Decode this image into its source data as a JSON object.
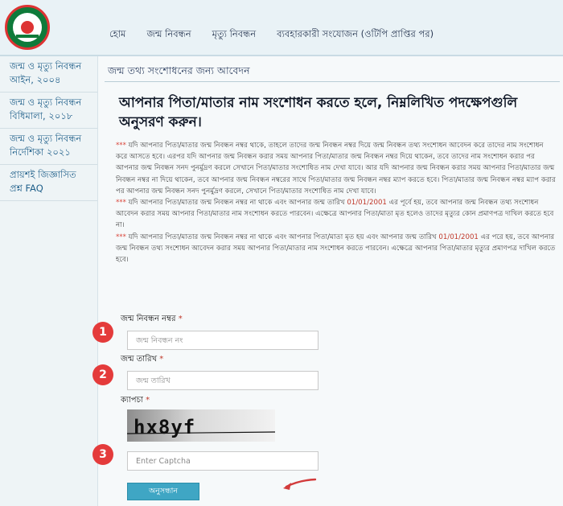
{
  "header": {
    "nav": [
      "হোম",
      "জন্ম নিবন্ধন",
      "মৃত্যু নিবন্ধন",
      "ব্যবহারকারী সংযোজন (ওটিপি প্রাপ্তির পর)"
    ]
  },
  "sidebar": {
    "items": [
      "জন্ম ও মৃত্যু নিবন্ধন আইন, ২০০৪",
      "জন্ম ও মৃত্যু নিবন্ধন বিধিমালা, ২০১৮",
      "জন্ম ও মৃত্যু নিবন্ধন নির্দেশিকা ২০২১",
      "প্রায়শই জিজ্ঞাসিত প্রশ্ন FAQ"
    ]
  },
  "main": {
    "page_title": "জন্ম তথ্য সংশোধনের জন্য আবেদন",
    "heading": "আপনার পিতা/মাতার নাম সংশোধন করতে হলে, নিম্নলিখিত পদক্ষেপগুলি অনুসরণ করুন।",
    "stars": "***",
    "para1": " যদি আপনার পিতা/মাতার জন্ম নিবন্ধন নম্বর থাকে, তাহলে তাদের জন্ম নিবন্ধন নম্বর দিয়ে জন্ম নিবন্ধন তথ্য সংশোধন আবেদন করে তাদের নাম সংশোধন করে আসতে হবে। এরপর যদি আপনার জন্ম নিবন্ধন করার সময় আপনার পিতা/মাতার জন্ম নিবন্ধন নম্বর দিয়ে থাকেন, তবে তাদের নাম সংশোধন করার পর আপনার জন্ম নিবন্ধন সনদ পুনর্মুদ্রণ করলে সেখানে পিতা/মাতার সংশোধিত নাম দেখা যাবে। আর যদি আপনার জন্ম নিবন্ধন করার সময় আপনার পিতা/মাতার জন্ম নিবন্ধন নম্বর না দিয়ে থাকেন, তবে আপনার জন্ম নিবন্ধন নম্বরের সাথে পিতা/মাতার জন্ম নিবন্ধন নম্বর ম্যাপ করতে হবে। পিতা/মাতার জন্ম নিবন্ধন নম্বর ম্যাপ করার পর আপনার জন্ম নিবন্ধন সনদ পুনর্মুদ্রণ করলে, সেখানে পিতা/মাতার সংশোধিত নাম দেখা যাবে।",
    "para2a": " যদি আপনার পিতা/মাতার জন্ম নিবন্ধন নম্বর না থাকে এবং আপনার জন্ম তারিখ ",
    "date": "01/01/2001",
    "para2b": " এর পূর্বে হয়, তবে আপনার জন্ম নিবন্ধন তথ্য সংশোধন আবেদন করার সময় আপনার পিতা/মাতার নাম সংশোধন করতে পারবেন। এক্ষেত্রে আপনার পিতা/মাতা মৃত হলেও তাদের মৃত্যুর কোন প্রমাণপত্র দাখিল করতে হবে না।",
    "para3a": " যদি আপনার পিতা/মাতার জন্ম নিবন্ধন নম্বর না থাকে এবং আপনার পিতা/মাতা মৃত হয় এবং আপনার জন্ম তারিখ ",
    "para3b": " এর পরে হয়, তবে আপনার জন্ম নিবন্ধন তথ্য সংশোধন আবেদন করার সময় আপনার পিতা/মাতার নাম সংশোধন করতে পারবেন। এক্ষেত্রে আপনার পিতা/মাতার মৃত্যুর প্রমাণপত্র দাখিল করতে হবে।"
  },
  "form": {
    "reg_label": "জন্ম নিবন্ধন নম্বর",
    "reg_placeholder": "জন্ম নিবন্ধন নং",
    "dob_label": "জন্ম তারিখ",
    "dob_placeholder": "জন্ম তারিখ",
    "captcha_label": "ক্যাপচা",
    "required": "*",
    "captcha_text": "hx8yf",
    "captcha_placeholder": "Enter Captcha",
    "submit": "অনুসন্ধান"
  },
  "markers": [
    "1",
    "2",
    "3"
  ]
}
